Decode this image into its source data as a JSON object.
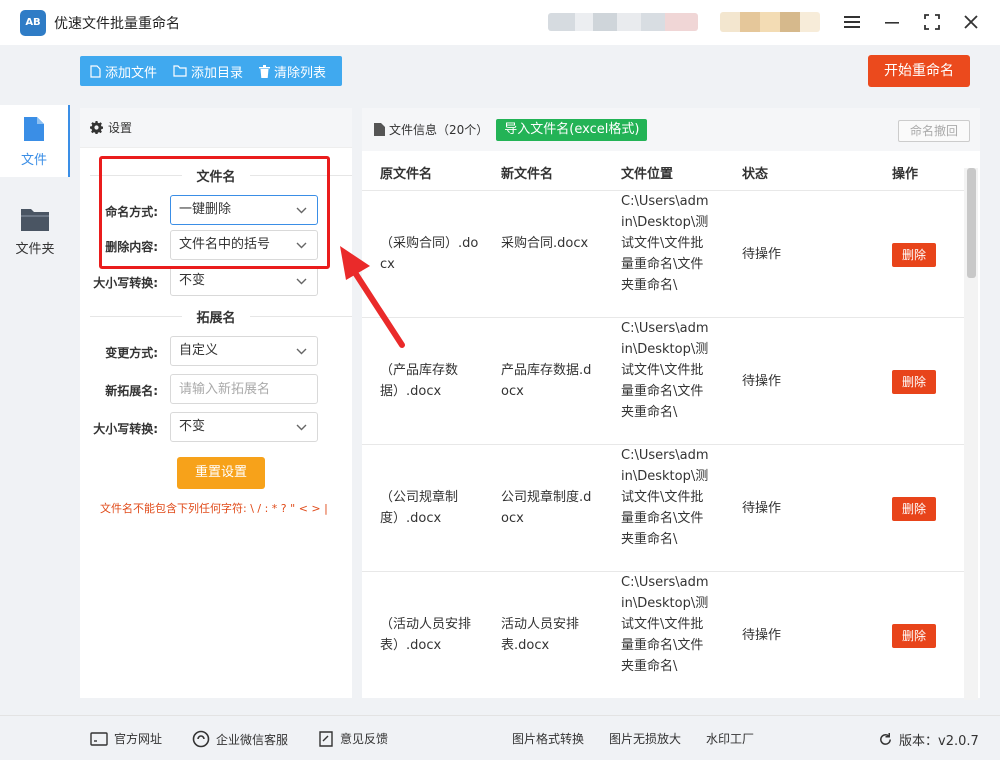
{
  "app": {
    "logo_text": "AB",
    "title": "优速文件批量重命名"
  },
  "nav": [
    {
      "label": "文件",
      "icon": "file-icon",
      "active": true
    },
    {
      "label": "文件夹",
      "icon": "folder-icon",
      "active": false
    }
  ],
  "toolbar": {
    "add_file": "添加文件",
    "add_dir": "添加目录",
    "clear_list": "清除列表",
    "start": "开始重命名"
  },
  "settings": {
    "header": "设置",
    "filename_section": "文件名",
    "naming_mode_label": "命名方式:",
    "naming_mode_value": "一键删除",
    "delete_content_label": "删除内容:",
    "delete_content_value": "文件名中的括号",
    "case_label": "大小写转换:",
    "case_value": "不变",
    "ext_section": "拓展名",
    "change_mode_label": "变更方式:",
    "change_mode_value": "自定义",
    "new_ext_label": "新拓展名:",
    "new_ext_placeholder": "请输入新拓展名",
    "ext_case_label": "大小写转换:",
    "ext_case_value": "不变",
    "reset": "重置设置",
    "warning": "文件名不能包含下列任何字符: \\ / : * ? \" < > |"
  },
  "files": {
    "info": "文件信息（20个）",
    "import_btn": "导入文件名(excel格式)",
    "undo": "命名撤回",
    "columns": [
      "原文件名",
      "新文件名",
      "文件位置",
      "状态",
      "操作"
    ],
    "rows": [
      {
        "original": "（采购合同）.docx",
        "new": "采购合同.docx",
        "location": "C:\\Users\\admin\\Desktop\\测试文件\\文件批量重命名\\文件夹重命名\\",
        "status": "待操作",
        "action": "删除"
      },
      {
        "original": "（产品库存数据）.docx",
        "new": "产品库存数据.docx",
        "location": "C:\\Users\\admin\\Desktop\\测试文件\\文件批量重命名\\文件夹重命名\\",
        "status": "待操作",
        "action": "删除"
      },
      {
        "original": "（公司规章制度）.docx",
        "new": "公司规章制度.docx",
        "location": "C:\\Users\\admin\\Desktop\\测试文件\\文件批量重命名\\文件夹重命名\\",
        "status": "待操作",
        "action": "删除"
      },
      {
        "original": "（活动人员安排表）.docx",
        "new": "活动人员安排表.docx",
        "location": "C:\\Users\\admin\\Desktop\\测试文件\\文件批量重命名\\文件夹重命名\\",
        "status": "待操作",
        "action": "删除"
      }
    ]
  },
  "footer": {
    "website": "官方网址",
    "wechat": "企业微信客服",
    "feedback": "意见反馈",
    "img_convert": "图片格式转换",
    "img_enlarge": "图片无损放大",
    "watermark": "水印工厂",
    "version": "版本：v2.0.7"
  },
  "colors": {
    "accent": "#40a9ef",
    "primary_orange": "#eb4a1d",
    "green": "#23b356",
    "highlight_red": "#ea1c1c"
  }
}
